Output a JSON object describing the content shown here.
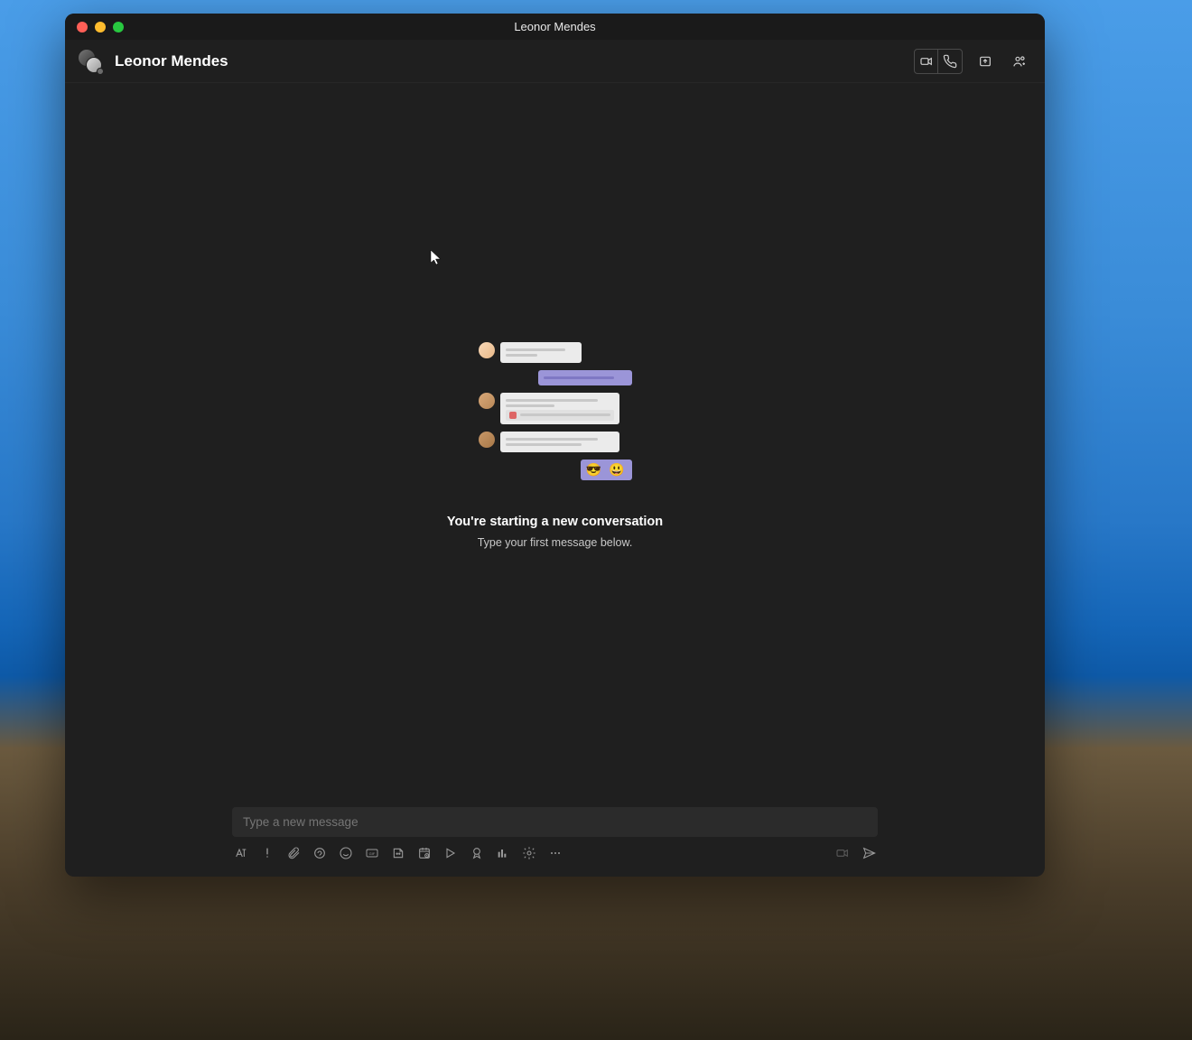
{
  "window": {
    "title": "Leonor Mendes"
  },
  "header": {
    "contact_name": "Leonor Mendes"
  },
  "empty_state": {
    "headline": "You're starting a new conversation",
    "subline": "Type your first message below.",
    "emoji": "😎 😃"
  },
  "composer": {
    "placeholder": "Type a new message"
  }
}
